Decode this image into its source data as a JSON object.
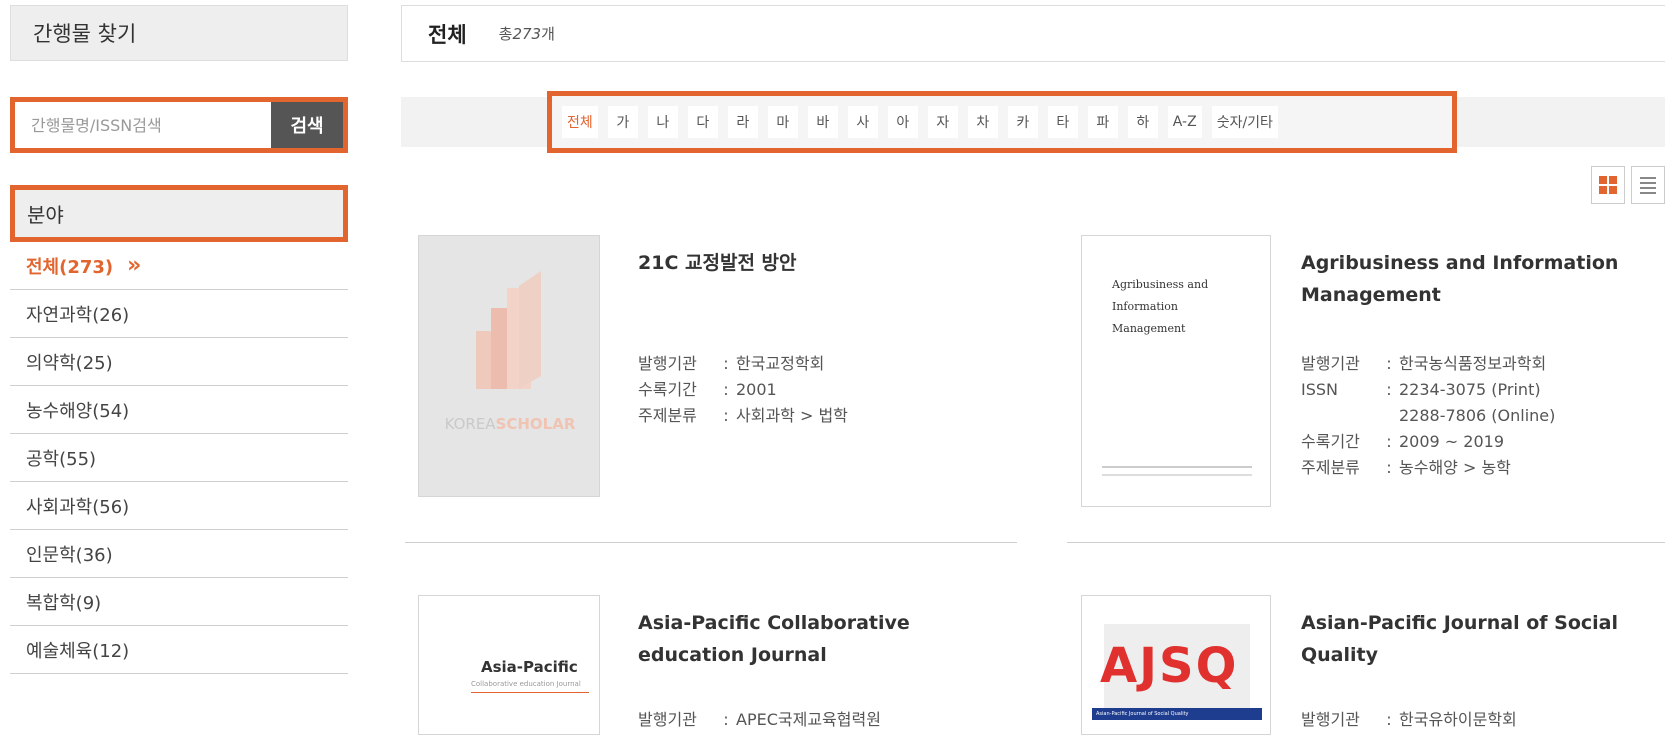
{
  "sidebar": {
    "title": "간행물 찾기",
    "search_placeholder": "간행물명/ISSN검색",
    "search_button": "검색",
    "field_header": "분야",
    "fields": [
      {
        "label": "전체(273)",
        "active": true
      },
      {
        "label": "자연과학(26)"
      },
      {
        "label": "의약학(25)"
      },
      {
        "label": "농수해양(54)"
      },
      {
        "label": "공학(55)"
      },
      {
        "label": "사회과학(56)"
      },
      {
        "label": "인문학(36)"
      },
      {
        "label": "복합학(9)"
      },
      {
        "label": "예술체육(12)"
      }
    ],
    "active_chevron": "»"
  },
  "main": {
    "heading": "전체",
    "count_prefix": "총",
    "count_value": "273",
    "count_suffix": "개",
    "index_tabs": [
      "전체",
      "가",
      "나",
      "다",
      "라",
      "마",
      "바",
      "사",
      "아",
      "자",
      "차",
      "카",
      "타",
      "파",
      "하",
      "A-Z",
      "숫자/기타"
    ],
    "index_selected": "전체"
  },
  "journals": [
    {
      "title": "21C 교정발전 방안",
      "cover_placeholder": "KOREASCHOLAR",
      "cover_placeholder_a": "KOREA",
      "cover_placeholder_b": "SCHOLAR",
      "meta": [
        {
          "key": "발행기관",
          "value": "한국교정학회"
        },
        {
          "key": "수록기간",
          "value": "2001"
        },
        {
          "key": "주제분류",
          "value": "사회과학 > 법학"
        }
      ]
    },
    {
      "title": "Agribusiness and Information Management",
      "cover_text_a": "Agribusiness and Information",
      "cover_text_b": "Management",
      "meta": [
        {
          "key": "발행기관",
          "value": "한국농식품정보과학회"
        },
        {
          "key": "ISSN",
          "value": "2234-3075 (Print)"
        },
        {
          "key": "",
          "value": "2288-7806 (Online)"
        },
        {
          "key": "수록기간",
          "value": "2009 ~ 2019"
        },
        {
          "key": "주제분류",
          "value": "농수해양 > 농학"
        }
      ]
    },
    {
      "title": "Asia-Pacific Collaborative education Journal",
      "cover_text_a": "Asia-Pacific",
      "cover_text_b": "Collaborative education Journal",
      "meta": [
        {
          "key": "발행기관",
          "value": "APEC국제교육협력원"
        }
      ]
    },
    {
      "title": "Asian-Pacific Journal of Social Quality",
      "cover_text_a": "AJSQ",
      "cover_text_b": "Asian-Pacific Journal of Social Quality",
      "meta": [
        {
          "key": "발행기관",
          "value": "한국유하이문학회"
        }
      ]
    }
  ],
  "colors": {
    "accent": "#e2652f",
    "panel": "#eeeeee",
    "text": "#333333"
  },
  "icons": [
    "grid-view-icon",
    "list-view-icon",
    "chevron-double-right-icon"
  ]
}
